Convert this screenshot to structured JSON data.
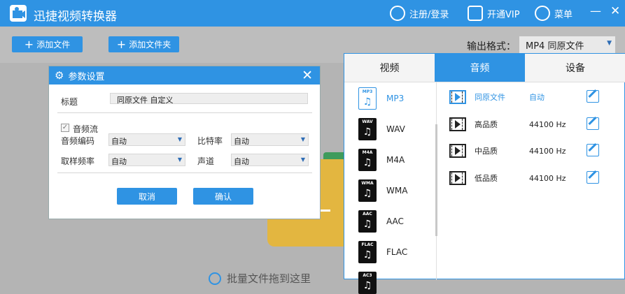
{
  "titlebar": {
    "title": "迅捷视频转换器",
    "login": "注册/登录",
    "vip": "开通VIP",
    "menu": "菜单",
    "minimize": "—",
    "close": "✕"
  },
  "toolbar": {
    "add_file": "添加文件",
    "add_folder": "添加文件夹",
    "output_label": "输出格式：",
    "output_value": "MP4  同原文件"
  },
  "hint": {
    "text": "批量文件拖到这里"
  },
  "dialog": {
    "title": "参数设置",
    "title_label": "标题",
    "title_value": "同原文件 自定义",
    "audio_stream": "音频流",
    "codec_label": "音频编码",
    "codec_value": "自动",
    "bitrate_label": "比特率",
    "bitrate_value": "自动",
    "samplerate_label": "取样频率",
    "samplerate_value": "自动",
    "channel_label": "声道",
    "channel_value": "自动",
    "cancel": "取消",
    "ok": "确认"
  },
  "panel": {
    "tabs": [
      "视频",
      "音频",
      "设备"
    ],
    "active_tab": 1,
    "formats": [
      {
        "name": "MP3",
        "active": true
      },
      {
        "name": "WAV",
        "active": false
      },
      {
        "name": "M4A",
        "active": false
      },
      {
        "name": "WMA",
        "active": false
      },
      {
        "name": "AAC",
        "active": false
      },
      {
        "name": "FLAC",
        "active": false
      },
      {
        "name": "AC3",
        "active": false
      }
    ],
    "qualities": [
      {
        "name": "同原文件",
        "rate": "自动",
        "active": true
      },
      {
        "name": "高品质",
        "rate": "44100 Hz",
        "active": false
      },
      {
        "name": "中品质",
        "rate": "44100 Hz",
        "active": false
      },
      {
        "name": "低品质",
        "rate": "44100 Hz",
        "active": false
      }
    ]
  },
  "colors": {
    "accent": "#2f93e3",
    "folder": "#e3b640"
  }
}
